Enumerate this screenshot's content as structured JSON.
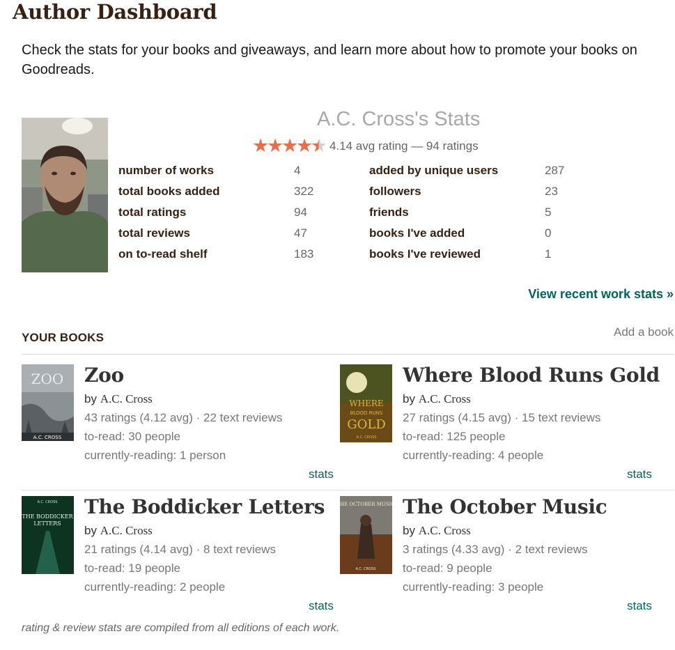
{
  "header": {
    "title": "Author Dashboard",
    "intro": "Check the stats for your books and giveaways, and learn more about how to promote your books on Goodreads."
  },
  "author_stats": {
    "title": "A.C. Cross's Stats",
    "avg_rating": 4.14,
    "rating_text": "4.14 avg rating — 94 ratings",
    "left": [
      {
        "label": "number of works",
        "value": "4"
      },
      {
        "label": "total books added",
        "value": "322"
      },
      {
        "label": "total ratings",
        "value": "94"
      },
      {
        "label": "total reviews",
        "value": "47"
      },
      {
        "label": "on to-read shelf",
        "value": "183"
      }
    ],
    "right": [
      {
        "label": "added by unique users",
        "value": "287"
      },
      {
        "label": "followers",
        "value": "23"
      },
      {
        "label": "friends",
        "value": "5"
      },
      {
        "label": "books I've added",
        "value": "0"
      },
      {
        "label": "books I've reviewed",
        "value": "1"
      }
    ],
    "recent_link": "View recent work stats »"
  },
  "books_section": {
    "heading": "YOUR BOOKS",
    "add_link": "Add a book"
  },
  "books": [
    {
      "title": "Zoo",
      "by": "by",
      "author": "A.C. Cross",
      "ratings": "43 ratings (4.12 avg) · 22 text reviews",
      "to_read": "to-read: 30 people",
      "reading": "currently-reading: 1 person",
      "stats": "stats"
    },
    {
      "title": "Where Blood Runs Gold",
      "by": "by",
      "author": "A.C. Cross",
      "ratings": "27 ratings (4.15 avg) · 15 text reviews",
      "to_read": "to-read: 125 people",
      "reading": "currently-reading: 4 people",
      "stats": "stats"
    },
    {
      "title": "The Boddicker Letters",
      "by": "by",
      "author": "A.C. Cross",
      "ratings": "21 ratings (4.14 avg) · 8 text reviews",
      "to_read": "to-read: 19 people",
      "reading": "currently-reading: 2 people",
      "stats": "stats"
    },
    {
      "title": "The October Music",
      "by": "by",
      "author": "A.C. Cross",
      "ratings": "3 ratings (4.33 avg) · 2 text reviews",
      "to_read": "to-read: 9 people",
      "reading": "currently-reading: 3 people",
      "stats": "stats"
    }
  ],
  "covers": {
    "zoo": {
      "text": "ZOO",
      "byline": "A.C. CROSS"
    },
    "gold": {
      "text_1": "WHERE",
      "text_2": "BLOOD RUNS",
      "text_3": "GOLD",
      "byline": "A.C. CROSS"
    },
    "boddicker": {
      "text_1": "A.C. CROSS",
      "text_2": "THE BODDICKER",
      "text_3": "LETTERS"
    },
    "october": {
      "text_1": "THE OCTOBER MUSIC",
      "text_2": "A.C. CROSS"
    }
  },
  "footnote": "rating & review stats are compiled from all editions of each work.",
  "colors": {
    "accent_link": "#00635d",
    "brown_heading": "#382110",
    "star": "#e96d49"
  },
  "icons": {
    "star": "star-icon"
  }
}
